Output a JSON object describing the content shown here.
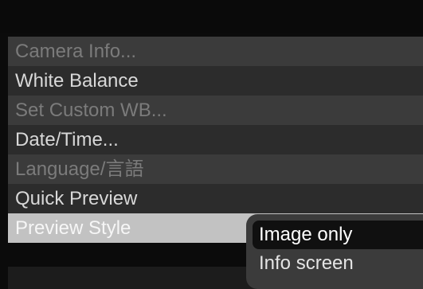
{
  "menu": {
    "items": [
      {
        "label": "Camera Info...",
        "state": "disabled"
      },
      {
        "label": "White Balance",
        "state": "enabled"
      },
      {
        "label": "Set Custom WB...",
        "state": "disabled"
      },
      {
        "label": "Date/Time...",
        "state": "enabled"
      },
      {
        "label": "Language/言語",
        "state": "disabled"
      },
      {
        "label": "Quick Preview",
        "state": "enabled"
      },
      {
        "label": "Preview Style",
        "state": "selected"
      }
    ]
  },
  "submenu": {
    "options": [
      {
        "label": "Image only",
        "highlighted": true
      },
      {
        "label": "Info screen",
        "highlighted": false
      }
    ]
  },
  "colors": {
    "background": "#0b0b0b",
    "row_odd": "#3b3b3b",
    "row_even": "#2c2c2c",
    "selected_row": "#c2c2c2",
    "text_enabled": "#d8d8d8",
    "text_disabled": "#7b7b7b",
    "submenu_bg": "#3b3b3b",
    "submenu_highlight": "#101010"
  }
}
